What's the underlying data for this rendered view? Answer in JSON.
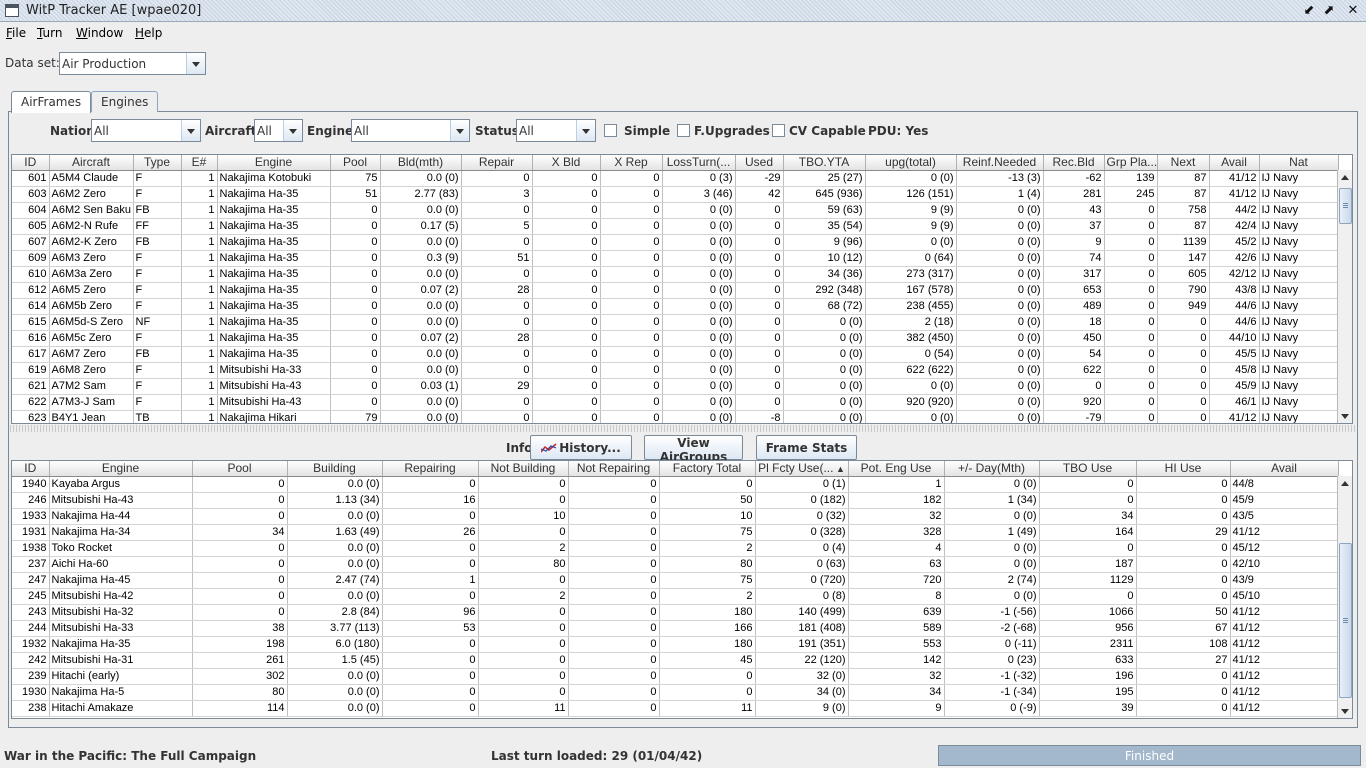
{
  "window": {
    "title": "WitP Tracker AE [wpae020]",
    "buttons": {
      "minimize": "⬋",
      "maximize": "⬈",
      "close": "✕"
    }
  },
  "menu": [
    "File",
    "Turn",
    "Window",
    "Help"
  ],
  "dataset": {
    "label": "Data set:",
    "value": "Air Production"
  },
  "tabs": [
    {
      "label": "AirFrames",
      "active": true
    },
    {
      "label": "Engines",
      "active": false
    }
  ],
  "filters": {
    "nation": {
      "label": "Nation:",
      "value": "All"
    },
    "aircraft": {
      "label": "Aircraft:",
      "value": "All"
    },
    "engine": {
      "label": "Engine:",
      "value": "All"
    },
    "status": {
      "label": "Status:",
      "value": "All"
    },
    "simple": {
      "label": "Simple",
      "checked": false
    },
    "fupgrades": {
      "label": "F.Upgrades",
      "checked": false
    },
    "cvcapable": {
      "label": "CV Capable",
      "checked": false
    },
    "pdu": "PDU: Yes"
  },
  "airframes": {
    "columns": [
      "ID",
      "Aircraft",
      "Type",
      "E#",
      "Engine",
      "Pool",
      "Bld(mth)",
      "Repair",
      "X Bld",
      "X Rep",
      "LossTurn(...",
      "Used",
      "TBO.YTA",
      "upg(total)",
      "Reinf.Needed",
      "Rec.Bld",
      "Grp Pla...",
      "Next",
      "Avail",
      "Nat"
    ],
    "rows": [
      [
        "601",
        "A5M4 Claude",
        "F",
        "1",
        "Nakajima Kotobuki",
        "75",
        "0.0 (0)",
        "0",
        "0",
        "0",
        "0 (3)",
        "-29",
        "25 (27)",
        "0 (0)",
        "-13 (3)",
        "-62",
        "139",
        "87",
        "41/12",
        "IJ Navy"
      ],
      [
        "603",
        "A6M2 Zero",
        "F",
        "1",
        "Nakajima Ha-35",
        "51",
        "2.77 (83)",
        "3",
        "0",
        "0",
        "3 (46)",
        "42",
        "645 (936)",
        "126 (151)",
        "1 (4)",
        "281",
        "245",
        "87",
        "41/12",
        "IJ Navy"
      ],
      [
        "604",
        "A6M2 Sen Baku",
        "FB",
        "1",
        "Nakajima Ha-35",
        "0",
        "0.0 (0)",
        "0",
        "0",
        "0",
        "0 (0)",
        "0",
        "59 (63)",
        "9 (9)",
        "0 (0)",
        "43",
        "0",
        "758",
        "44/2",
        "IJ Navy"
      ],
      [
        "605",
        "A6M2-N Rufe",
        "FF",
        "1",
        "Nakajima Ha-35",
        "0",
        "0.17 (5)",
        "5",
        "0",
        "0",
        "0 (0)",
        "0",
        "35 (54)",
        "9 (9)",
        "0 (0)",
        "37",
        "0",
        "87",
        "42/4",
        "IJ Navy"
      ],
      [
        "607",
        "A6M2-K Zero",
        "FB",
        "1",
        "Nakajima Ha-35",
        "0",
        "0.0 (0)",
        "0",
        "0",
        "0",
        "0 (0)",
        "0",
        "9 (96)",
        "0 (0)",
        "0 (0)",
        "9",
        "0",
        "1139",
        "45/2",
        "IJ Navy"
      ],
      [
        "609",
        "A6M3 Zero",
        "F",
        "1",
        "Nakajima Ha-35",
        "0",
        "0.3 (9)",
        "51",
        "0",
        "0",
        "0 (0)",
        "0",
        "10 (12)",
        "0 (64)",
        "0 (0)",
        "74",
        "0",
        "147",
        "42/6",
        "IJ Navy"
      ],
      [
        "610",
        "A6M3a Zero",
        "F",
        "1",
        "Nakajima Ha-35",
        "0",
        "0.0 (0)",
        "0",
        "0",
        "0",
        "0 (0)",
        "0",
        "34 (36)",
        "273 (317)",
        "0 (0)",
        "317",
        "0",
        "605",
        "42/12",
        "IJ Navy"
      ],
      [
        "612",
        "A6M5 Zero",
        "F",
        "1",
        "Nakajima Ha-35",
        "0",
        "0.07 (2)",
        "28",
        "0",
        "0",
        "0 (0)",
        "0",
        "292 (348)",
        "167 (578)",
        "0 (0)",
        "653",
        "0",
        "790",
        "43/8",
        "IJ Navy"
      ],
      [
        "614",
        "A6M5b Zero",
        "F",
        "1",
        "Nakajima Ha-35",
        "0",
        "0.0 (0)",
        "0",
        "0",
        "0",
        "0 (0)",
        "0",
        "68 (72)",
        "238 (455)",
        "0 (0)",
        "489",
        "0",
        "949",
        "44/6",
        "IJ Navy"
      ],
      [
        "615",
        "A6M5d-S Zero",
        "NF",
        "1",
        "Nakajima Ha-35",
        "0",
        "0.0 (0)",
        "0",
        "0",
        "0",
        "0 (0)",
        "0",
        "0 (0)",
        "2 (18)",
        "0 (0)",
        "18",
        "0",
        "0",
        "44/6",
        "IJ Navy"
      ],
      [
        "616",
        "A6M5c Zero",
        "F",
        "1",
        "Nakajima Ha-35",
        "0",
        "0.07 (2)",
        "28",
        "0",
        "0",
        "0 (0)",
        "0",
        "0 (0)",
        "382 (450)",
        "0 (0)",
        "450",
        "0",
        "0",
        "44/10",
        "IJ Navy"
      ],
      [
        "617",
        "A6M7 Zero",
        "FB",
        "1",
        "Nakajima Ha-35",
        "0",
        "0.0 (0)",
        "0",
        "0",
        "0",
        "0 (0)",
        "0",
        "0 (0)",
        "0 (54)",
        "0 (0)",
        "54",
        "0",
        "0",
        "45/5",
        "IJ Navy"
      ],
      [
        "619",
        "A6M8 Zero",
        "F",
        "1",
        "Mitsubishi Ha-33",
        "0",
        "0.0 (0)",
        "0",
        "0",
        "0",
        "0 (0)",
        "0",
        "0 (0)",
        "622 (622)",
        "0 (0)",
        "622",
        "0",
        "0",
        "45/8",
        "IJ Navy"
      ],
      [
        "621",
        "A7M2 Sam",
        "F",
        "1",
        "Mitsubishi Ha-43",
        "0",
        "0.03 (1)",
        "29",
        "0",
        "0",
        "0 (0)",
        "0",
        "0 (0)",
        "0 (0)",
        "0 (0)",
        "0",
        "0",
        "0",
        "45/9",
        "IJ Navy"
      ],
      [
        "622",
        "A7M3-J Sam",
        "F",
        "1",
        "Mitsubishi Ha-43",
        "0",
        "0.0 (0)",
        "0",
        "0",
        "0",
        "0 (0)",
        "0",
        "0 (0)",
        "920 (920)",
        "0 (0)",
        "920",
        "0",
        "0",
        "46/1",
        "IJ Navy"
      ],
      [
        "623",
        "B4Y1 Jean",
        "TB",
        "1",
        "Nakajima Hikari",
        "79",
        "0.0 (0)",
        "0",
        "0",
        "0",
        "0 (0)",
        "-8",
        "0 (0)",
        "0 (0)",
        "0 (0)",
        "-79",
        "0",
        "0",
        "41/12",
        "IJ Navy"
      ]
    ]
  },
  "info": {
    "label": "Info:",
    "buttons": [
      "History...",
      "View AirGroups",
      "Frame Stats"
    ]
  },
  "engines": {
    "columns": [
      "ID",
      "Engine",
      "Pool",
      "Building",
      "Repairing",
      "Not Building",
      "Not Repairing",
      "Factory Total",
      "Pl Fcty Use(...",
      "Pot. Eng Use",
      "+/- Day(Mth)",
      "TBO Use",
      "HI Use",
      "Avail"
    ],
    "rows": [
      [
        "1940",
        "Kayaba Argus",
        "0",
        "0.0 (0)",
        "0",
        "0",
        "0",
        "0",
        "0 (1)",
        "1",
        "0 (0)",
        "0",
        "0",
        "44/8"
      ],
      [
        "246",
        "Mitsubishi Ha-43",
        "0",
        "1.13 (34)",
        "16",
        "0",
        "0",
        "50",
        "0 (182)",
        "182",
        "1 (34)",
        "0",
        "0",
        "45/9"
      ],
      [
        "1933",
        "Nakajima Ha-44",
        "0",
        "0.0 (0)",
        "0",
        "10",
        "0",
        "10",
        "0 (32)",
        "32",
        "0 (0)",
        "34",
        "0",
        "43/5"
      ],
      [
        "1931",
        "Nakajima Ha-34",
        "34",
        "1.63 (49)",
        "26",
        "0",
        "0",
        "75",
        "0 (328)",
        "328",
        "1 (49)",
        "164",
        "29",
        "41/12"
      ],
      [
        "1938",
        "Toko Rocket",
        "0",
        "0.0 (0)",
        "0",
        "2",
        "0",
        "2",
        "0 (4)",
        "4",
        "0 (0)",
        "0",
        "0",
        "45/12"
      ],
      [
        "237",
        "Aichi Ha-60",
        "0",
        "0.0 (0)",
        "0",
        "80",
        "0",
        "80",
        "0 (63)",
        "63",
        "0 (0)",
        "187",
        "0",
        "42/10"
      ],
      [
        "247",
        "Nakajima Ha-45",
        "0",
        "2.47 (74)",
        "1",
        "0",
        "0",
        "75",
        "0 (720)",
        "720",
        "2 (74)",
        "1129",
        "0",
        "43/9"
      ],
      [
        "245",
        "Mitsubishi Ha-42",
        "0",
        "0.0 (0)",
        "0",
        "2",
        "0",
        "2",
        "0 (8)",
        "8",
        "0 (0)",
        "0",
        "0",
        "45/10"
      ],
      [
        "243",
        "Mitsubishi Ha-32",
        "0",
        "2.8 (84)",
        "96",
        "0",
        "0",
        "180",
        "140 (499)",
        "639",
        "-1 (-56)",
        "1066",
        "50",
        "41/12"
      ],
      [
        "244",
        "Mitsubishi Ha-33",
        "38",
        "3.77 (113)",
        "53",
        "0",
        "0",
        "166",
        "181 (408)",
        "589",
        "-2 (-68)",
        "956",
        "67",
        "41/12"
      ],
      [
        "1932",
        "Nakajima Ha-35",
        "198",
        "6.0 (180)",
        "0",
        "0",
        "0",
        "180",
        "191 (351)",
        "553",
        "0 (-11)",
        "2311",
        "108",
        "41/12"
      ],
      [
        "242",
        "Mitsubishi Ha-31",
        "261",
        "1.5 (45)",
        "0",
        "0",
        "0",
        "45",
        "22 (120)",
        "142",
        "0 (23)",
        "633",
        "27",
        "41/12"
      ],
      [
        "239",
        "Hitachi (early)",
        "302",
        "0.0 (0)",
        "0",
        "0",
        "0",
        "0",
        "32 (0)",
        "32",
        "-1 (-32)",
        "196",
        "0",
        "41/12"
      ],
      [
        "1930",
        "Nakajima Ha-5",
        "80",
        "0.0 (0)",
        "0",
        "0",
        "0",
        "0",
        "34 (0)",
        "34",
        "-1 (-34)",
        "195",
        "0",
        "41/12"
      ],
      [
        "238",
        "Hitachi Amakaze",
        "114",
        "0.0 (0)",
        "0",
        "11",
        "0",
        "11",
        "9 (0)",
        "9",
        "0 (-9)",
        "39",
        "0",
        "41/12"
      ]
    ]
  },
  "status": {
    "left": "War in the Pacific: The Full Campaign",
    "middle": "Last turn loaded: 29 (01/04/42)",
    "progress_text": "Finished",
    "progress_fraction": 1.0
  },
  "colors": {
    "accent": "#7a8a99",
    "progress": "#a3b8cc",
    "title_stripe": "#c7d3e0"
  }
}
